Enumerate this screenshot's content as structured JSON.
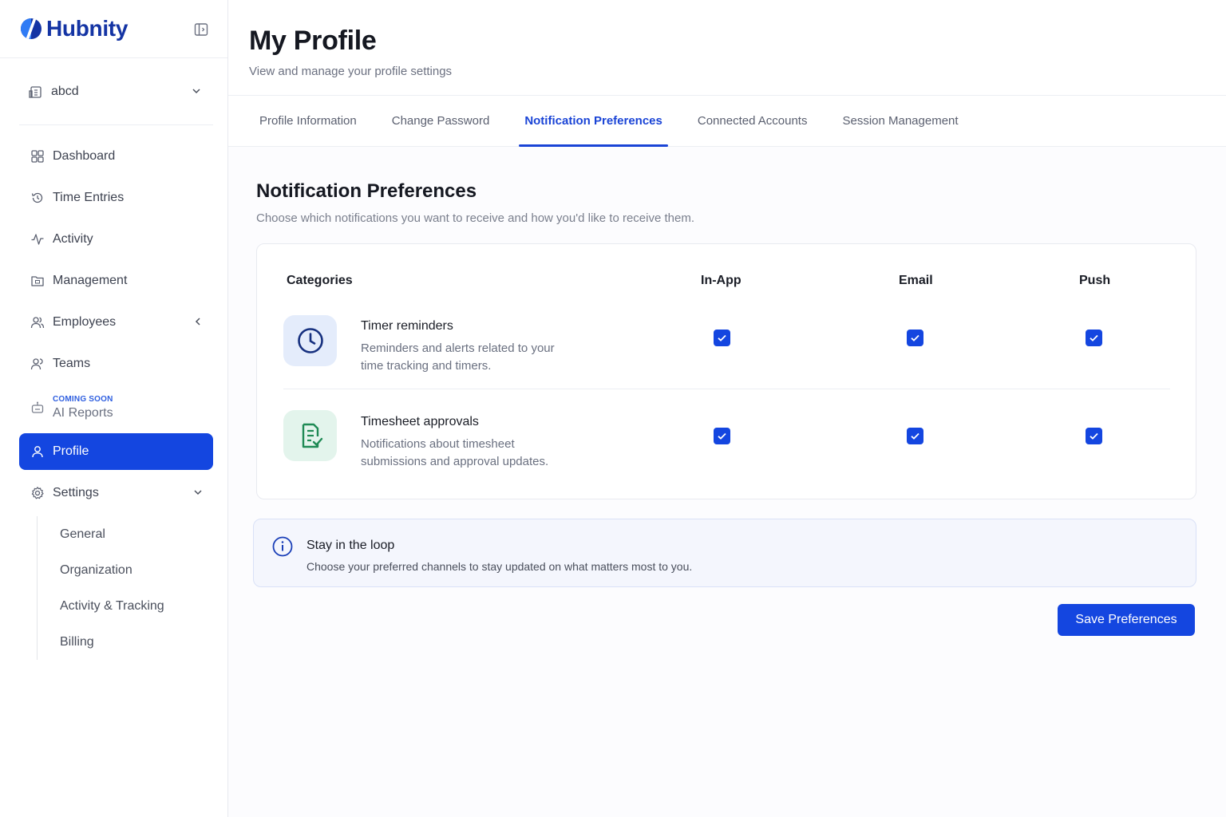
{
  "brand": {
    "name": "Hubnity"
  },
  "workspace": {
    "name": "abcd"
  },
  "sidebar": {
    "items": [
      {
        "label": "Dashboard",
        "icon": "grid-icon"
      },
      {
        "label": "Time Entries",
        "icon": "history-icon"
      },
      {
        "label": "Activity",
        "icon": "activity-icon"
      },
      {
        "label": "Management",
        "icon": "folder-icon"
      },
      {
        "label": "Employees",
        "icon": "users-icon"
      },
      {
        "label": "Teams",
        "icon": "team-icon"
      },
      {
        "label": "AI Reports",
        "icon": "robot-icon",
        "tag": "COMING SOON"
      },
      {
        "label": "Profile",
        "icon": "user-icon",
        "active": true
      },
      {
        "label": "Settings",
        "icon": "gear-icon"
      }
    ],
    "settings_sub": [
      "General",
      "Organization",
      "Activity & Tracking",
      "Billing"
    ]
  },
  "header": {
    "title": "My Profile",
    "subtitle": "View and manage your profile settings"
  },
  "tabs": [
    {
      "label": "Profile Information"
    },
    {
      "label": "Change Password"
    },
    {
      "label": "Notification Preferences",
      "active": true
    },
    {
      "label": "Connected Accounts"
    },
    {
      "label": "Session Management"
    }
  ],
  "section": {
    "title": "Notification Preferences",
    "subtitle": "Choose which notifications you want to receive and how you'd like to receive them."
  },
  "table": {
    "columns": [
      "Categories",
      "In-App",
      "Email",
      "Push"
    ],
    "rows": [
      {
        "title": "Timer reminders",
        "desc": "Reminders and alerts related to your time tracking and timers.",
        "icon": "clock-icon",
        "in_app": true,
        "email": true,
        "push": true
      },
      {
        "title": "Timesheet approvals",
        "desc": "Notifications about timesheet submissions and approval updates.",
        "icon": "checklist-icon",
        "in_app": true,
        "email": true,
        "push": true
      }
    ]
  },
  "info": {
    "title": "Stay in the loop",
    "desc": "Choose your preferred channels to stay updated on what matters most to you."
  },
  "actions": {
    "save_label": "Save Preferences"
  },
  "colors": {
    "accent": "#1446e0",
    "brand": "#1434a4"
  }
}
